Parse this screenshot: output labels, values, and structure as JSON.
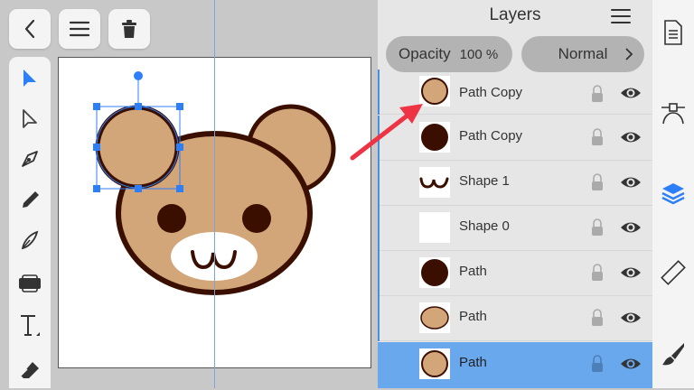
{
  "layers_panel": {
    "title": "Layers",
    "opacity_label": "Opacity",
    "opacity_value": "100 %",
    "blend_mode": "Normal",
    "layers": [
      {
        "name": "Path Copy",
        "thumb": "tan-circle"
      },
      {
        "name": "Path Copy",
        "thumb": "dark-circle"
      },
      {
        "name": "Shape 1",
        "thumb": "mouth"
      },
      {
        "name": "Shape 0",
        "thumb": "blank"
      },
      {
        "name": "Path",
        "thumb": "dark-circle"
      },
      {
        "name": "Path",
        "thumb": "tan-ellipse"
      },
      {
        "name": "Path",
        "thumb": "tan-circle",
        "selected": true
      }
    ]
  },
  "colors": {
    "accent": "#2d7ff9",
    "selection_row": "#6aa8ee",
    "bear_fill": "#d2a679",
    "bear_outline": "#3b0f00",
    "annotation_arrow": "#ee3344"
  },
  "icons": {
    "top": [
      "back-icon",
      "menu-icon",
      "trash-icon"
    ],
    "tools": [
      "move-tool-icon",
      "node-tool-icon",
      "pen-tool-icon",
      "pencil-tool-icon",
      "vector-brush-icon",
      "fill-tool-icon",
      "text-tool-icon",
      "eraser-tool-icon"
    ],
    "right": [
      "document-icon",
      "node-panel-icon",
      "layers-icon",
      "ruler-icon",
      "brush-icon"
    ]
  }
}
